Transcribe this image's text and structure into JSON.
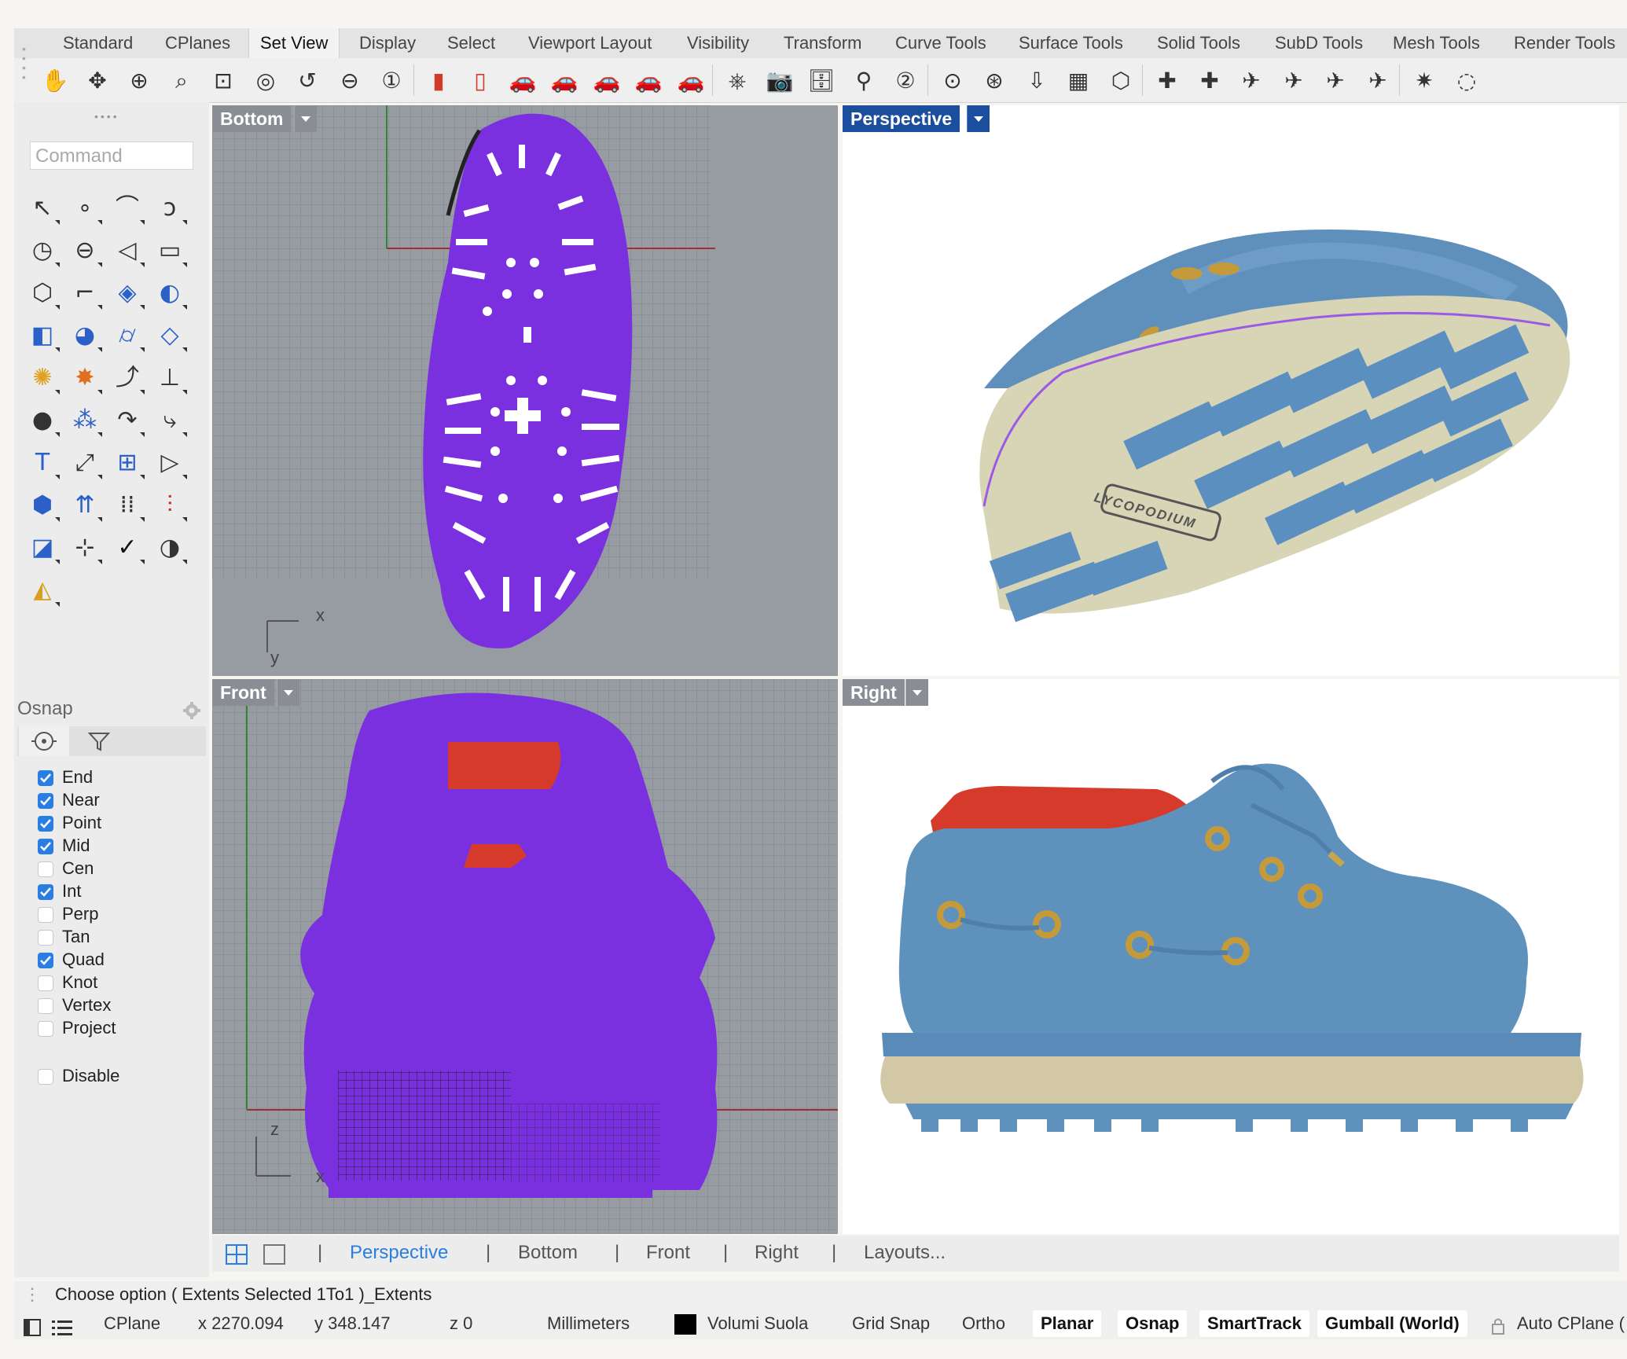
{
  "tabs": [
    "Standard",
    "CPlanes",
    "Set View",
    "Display",
    "Select",
    "Viewport Layout",
    "Visibility",
    "Transform",
    "Curve Tools",
    "Surface Tools",
    "Solid Tools",
    "SubD Tools",
    "Mesh Tools",
    "Render Tools"
  ],
  "active_tab": "Set View",
  "toolbar_icons": [
    "pan-icon",
    "rotate-view-icon",
    "zoom-dynamic-icon",
    "zoom-extents-icon",
    "zoom-window-icon",
    "zoom-selected-icon",
    "undo-view-icon",
    "zoom-out-icon",
    "zoom-1to1-icon",
    "named-view-top-icon",
    "named-view-bottom-icon",
    "car-front-icon",
    "car-left-icon",
    "car-right-icon",
    "car-back-icon",
    "car-perspective-icon",
    "place-camera-icon",
    "camera-icon",
    "save-view-icon",
    "set-camera-target-icon",
    "two-point-perspective-icon",
    "cplane-origin-icon",
    "set-target-icon",
    "plan-view-icon",
    "photo-icon",
    "box-view-icon",
    "cplane-top-icon",
    "cplane-front-icon",
    "airplane-top-icon",
    "airplane-bottom-icon",
    "airplane-left-icon",
    "airplane-right-icon",
    "compass-icon",
    "orbit-icon"
  ],
  "command": {
    "placeholder": "Command"
  },
  "left_tools": [
    "select-icon",
    "point-icon",
    "polyline-icon",
    "curve-icon",
    "circle-icon",
    "ellipse-icon",
    "arc-icon",
    "rectangle-icon",
    "polygon-icon",
    "fillet-icon",
    "surface-icon",
    "patch-icon",
    "box-icon",
    "sphere-icon",
    "cylinder-icon",
    "plane-icon",
    "boolean-icon",
    "explode-icon",
    "trim-icon",
    "split-icon",
    "union-icon",
    "group-icon",
    "curve-offset-icon",
    "fillet-curve-icon",
    "text-icon",
    "scale-icon",
    "array-icon",
    "mirror-icon",
    "block-icon",
    "dimension-icon",
    "grid-icon",
    "align-icon",
    "layout-icon",
    "gumball-icon",
    "check-icon",
    "render-icon",
    "paint-icon"
  ],
  "osnap": {
    "title": "Osnap",
    "items": [
      {
        "label": "End",
        "checked": true
      },
      {
        "label": "Near",
        "checked": true
      },
      {
        "label": "Point",
        "checked": true
      },
      {
        "label": "Mid",
        "checked": true
      },
      {
        "label": "Cen",
        "checked": false
      },
      {
        "label": "Int",
        "checked": true
      },
      {
        "label": "Perp",
        "checked": false
      },
      {
        "label": "Tan",
        "checked": false
      },
      {
        "label": "Quad",
        "checked": true
      },
      {
        "label": "Knot",
        "checked": false
      },
      {
        "label": "Vertex",
        "checked": false
      },
      {
        "label": "Project",
        "checked": false
      }
    ],
    "disable": {
      "label": "Disable",
      "checked": false
    }
  },
  "viewports": {
    "bottom": {
      "title": "Bottom",
      "axis_x": "x",
      "axis_y": "y"
    },
    "perspective": {
      "title": "Perspective",
      "sole_logo": "LYCOPODIUM"
    },
    "front": {
      "title": "Front",
      "axis_x": "x",
      "axis_z": "z"
    },
    "right": {
      "title": "Right"
    }
  },
  "view_tabs": [
    "Perspective",
    "Bottom",
    "Front",
    "Right",
    "Layouts..."
  ],
  "active_view_tab": "Perspective",
  "command_line": "Choose option ( Extents Selected 1To1 )_Extents",
  "status": {
    "cplane": "CPlane",
    "x": "x 2270.094",
    "y": "y 348.147",
    "z": "z 0",
    "units": "Millimeters",
    "layer": "Volumi Suola",
    "layer_color": "#000000",
    "grid_snap": "Grid Snap",
    "ortho": "Ortho",
    "planar": "Planar",
    "osnap": "Osnap",
    "smarttrack": "SmartTrack",
    "gumball": "Gumball (World)",
    "auto_cplane": "Auto CPlane ("
  },
  "colors": {
    "accent": "#2a7de1",
    "viewport_title": "#888888",
    "viewport_title_active": "#1c4e9e",
    "shoe_blue": "#5f91bd",
    "wire_purple": "#7a2ee0",
    "sole_cream": "#d8d4b6",
    "lining_red": "#d53a2a"
  }
}
